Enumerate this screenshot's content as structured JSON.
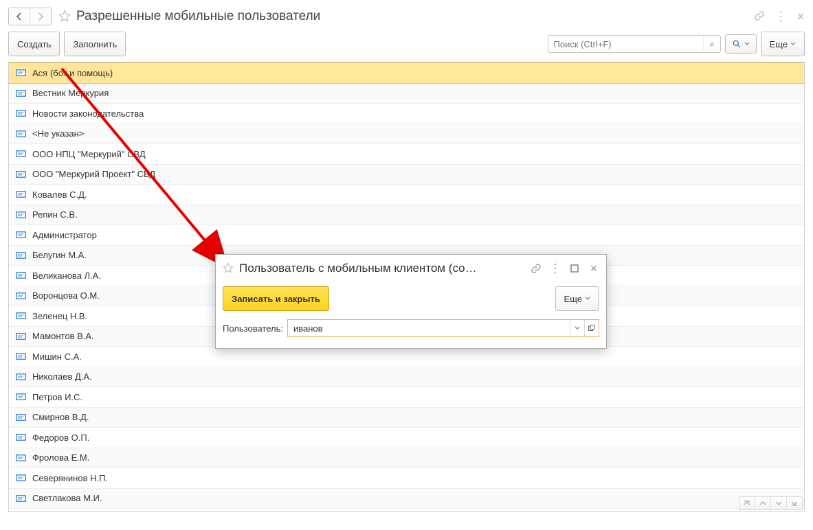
{
  "header": {
    "title": "Разрешенные мобильные пользователи"
  },
  "toolbar": {
    "create_label": "Создать",
    "fill_label": "Заполнить",
    "more_label": "Еще",
    "search_placeholder": "Поиск (Ctrl+F)",
    "search_clear": "×"
  },
  "list": {
    "rows": [
      "Ася (бот и помощь)",
      "Вестник Меркурия",
      "Новости законодательства",
      "<Не указан>",
      "ООО НПЦ \"Меркурий\" СВД",
      "ООО \"Меркурий Проект\" СВД",
      "Ковалев С.Д.",
      "Репин С.В.",
      "Администратор",
      "Белугин М.А.",
      "Великанова Л.А.",
      "Воронцова О.М.",
      "Зеленец Н.В.",
      "Мамонтов В.А.",
      "Мишин С.А.",
      "Николаев Д.А.",
      "Петров И.С.",
      "Смирнов В.Д.",
      "Федоров О.П.",
      "Фролова Е.М.",
      "Северянинов Н.П.",
      "Светлакова М.И."
    ]
  },
  "dialog": {
    "title": "Пользователь с мобильным клиентом (со…",
    "save_close_label": "Записать и закрыть",
    "more_label": "Еще",
    "field_label": "Пользователь:",
    "field_value": "иванов"
  }
}
